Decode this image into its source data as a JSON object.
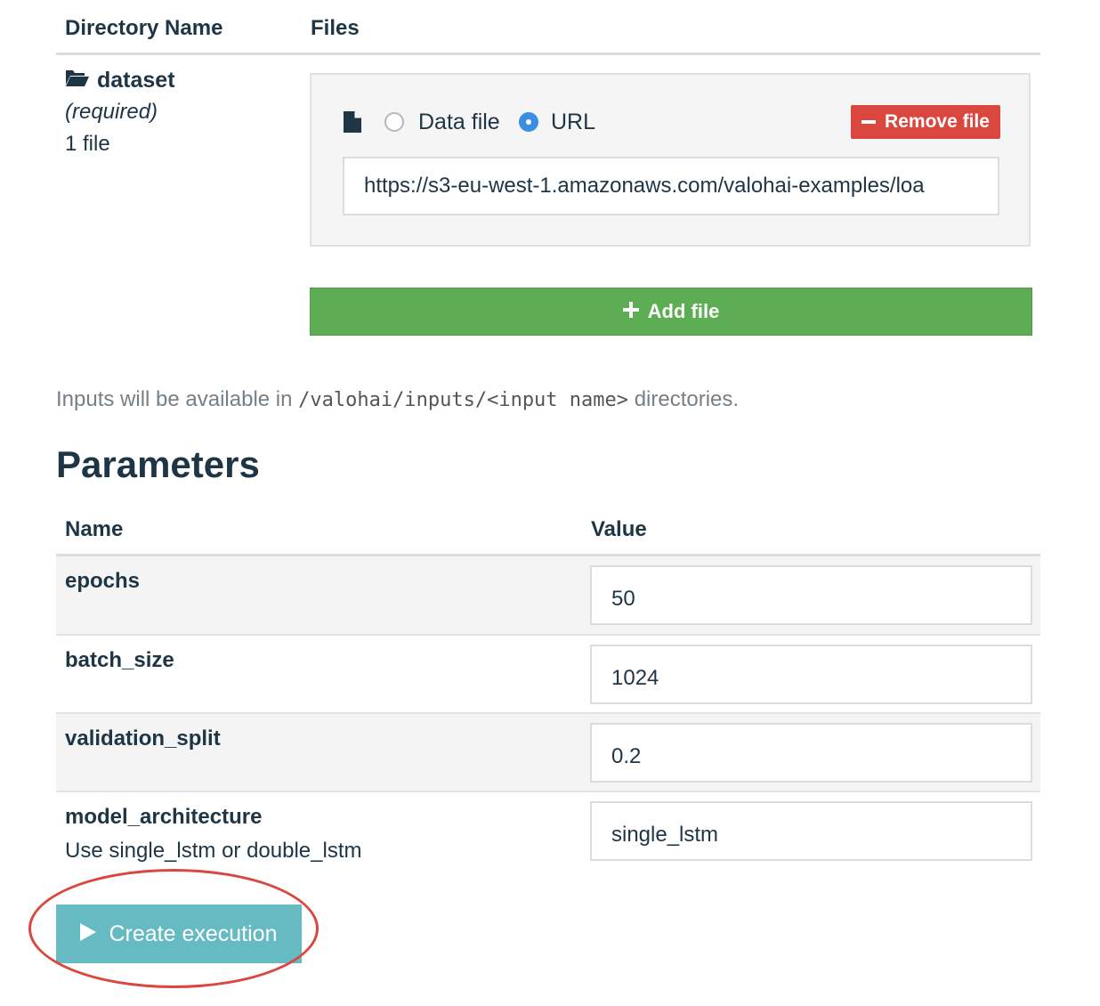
{
  "inputs": {
    "col_directory": "Directory Name",
    "col_files": "Files",
    "directory": {
      "name": "dataset",
      "required": "(required)",
      "count": "1 file",
      "icon": "folder-open-icon"
    },
    "file": {
      "icon": "file-icon",
      "option_data_file": "Data file",
      "option_url": "URL",
      "selected": "URL",
      "remove_label": "Remove file",
      "url_value": "https://s3-eu-west-1.amazonaws.com/valohai-examples/loa"
    },
    "add_file_label": "Add file",
    "help_prefix": "Inputs will be available in ",
    "help_code": "/valohai/inputs/<input name>",
    "help_suffix": " directories."
  },
  "parameters": {
    "title": "Parameters",
    "col_name": "Name",
    "col_value": "Value",
    "rows": [
      {
        "name": "epochs",
        "value": "50",
        "description": ""
      },
      {
        "name": "batch_size",
        "value": "1024",
        "description": ""
      },
      {
        "name": "validation_split",
        "value": "0.2",
        "description": ""
      },
      {
        "name": "model_architecture",
        "value": "single_lstm",
        "description": "Use single_lstm or double_lstm"
      }
    ]
  },
  "actions": {
    "create_execution_label": "Create execution"
  },
  "colors": {
    "remove": "#d9473f",
    "add": "#5cad53",
    "create": "#66bbc3",
    "radio_selected": "#3b8fe0",
    "annotation": "#d9473f"
  }
}
